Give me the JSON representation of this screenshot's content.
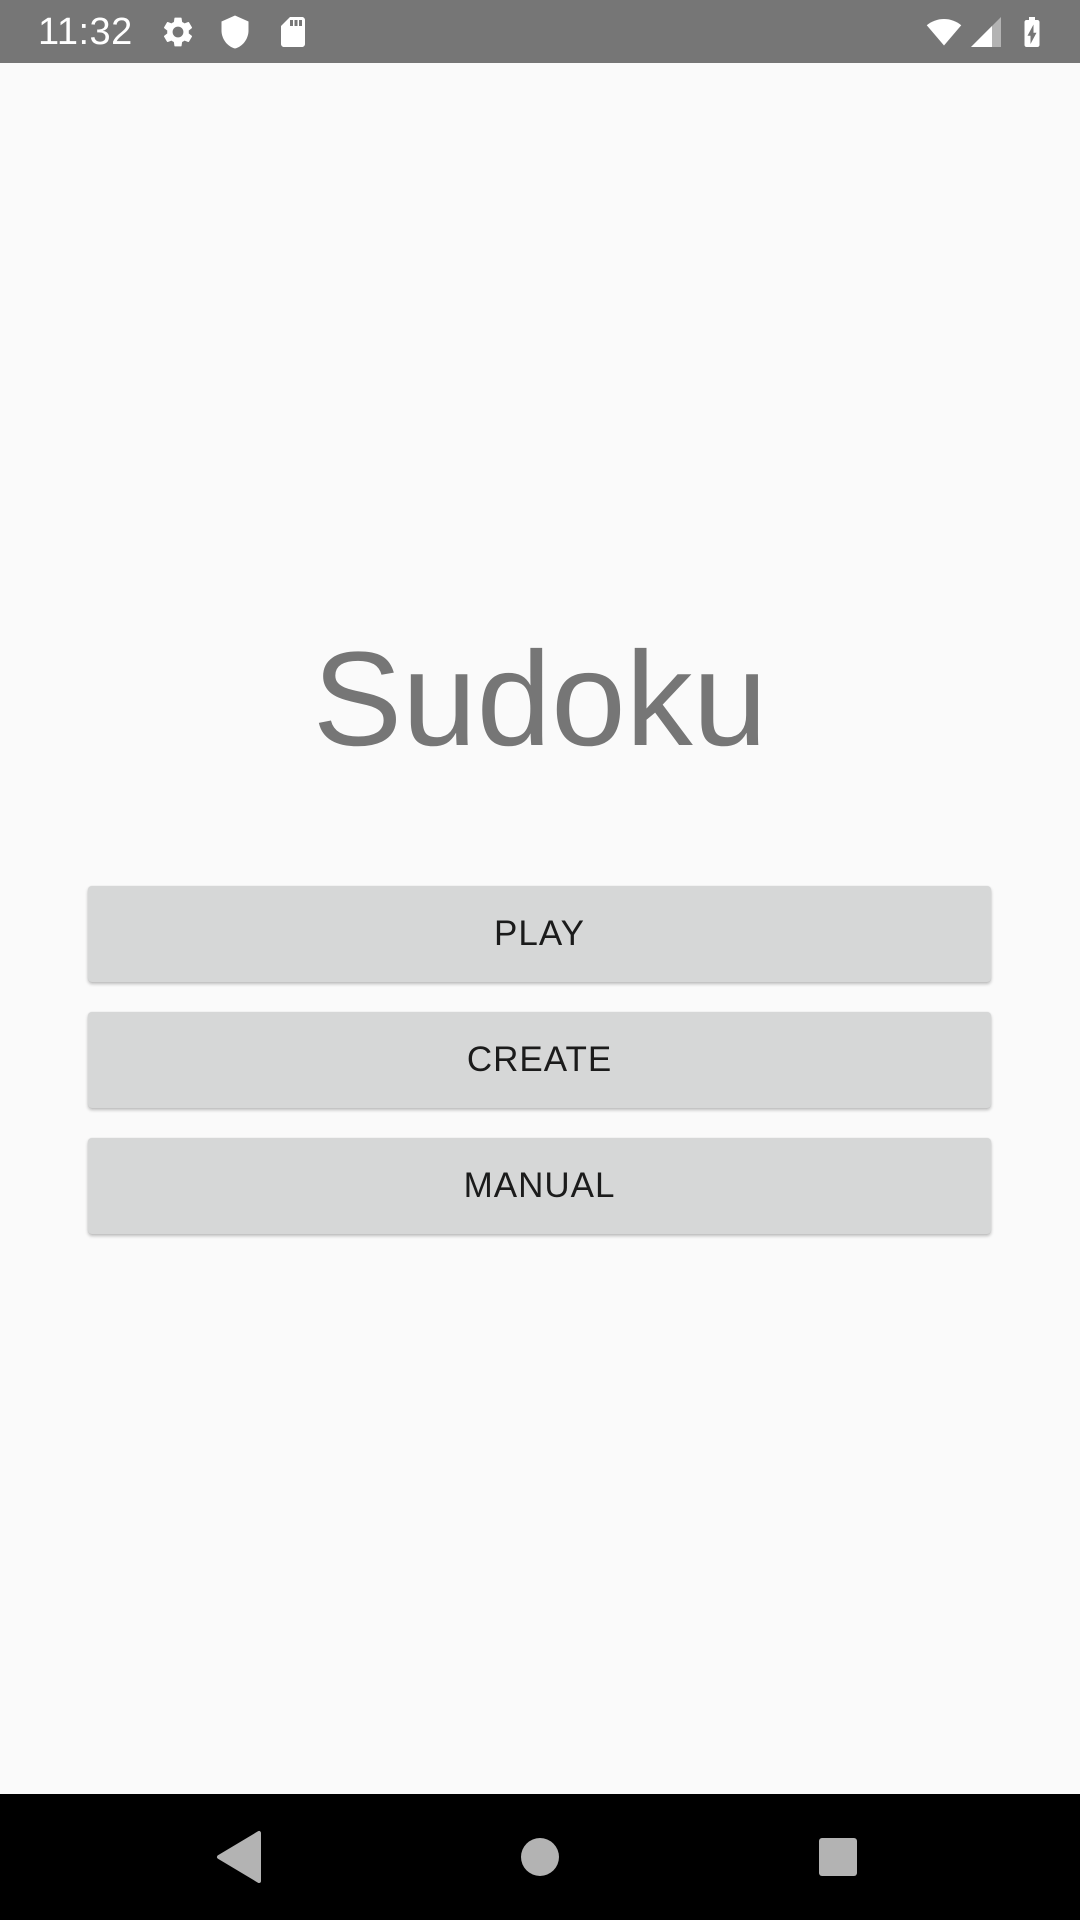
{
  "status_bar": {
    "time": "11:32",
    "icons_left": [
      "gear-icon",
      "shield-icon",
      "sd-card-icon"
    ],
    "icons_right": [
      "wifi-icon",
      "signal-icon",
      "battery-charging-icon"
    ],
    "background": "#767676"
  },
  "main": {
    "title": "Sudoku",
    "title_color": "#767676",
    "buttons": [
      {
        "label": "PLAY"
      },
      {
        "label": "CREATE"
      },
      {
        "label": "MANUAL"
      }
    ],
    "button_color": "#d6d7d7"
  },
  "nav_bar": {
    "buttons": [
      "back-icon",
      "home-icon",
      "recents-icon"
    ],
    "background": "#000000"
  }
}
